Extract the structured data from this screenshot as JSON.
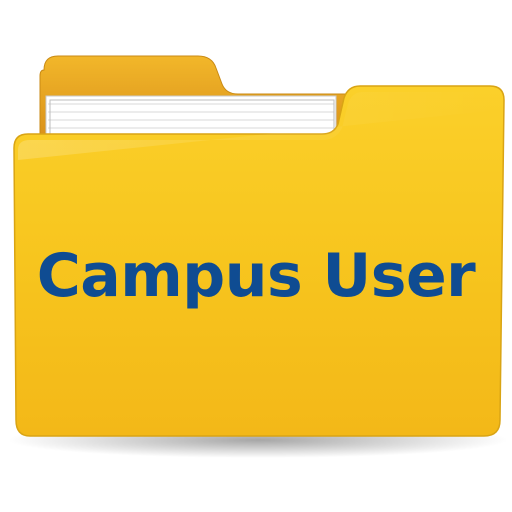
{
  "folder": {
    "icon": "folder-icon",
    "label": "Campus User"
  },
  "colors": {
    "label_text": "#0f4c92",
    "folder_front": "#f7c51e",
    "folder_back": "#e9a91a",
    "paper": "#ffffff"
  }
}
